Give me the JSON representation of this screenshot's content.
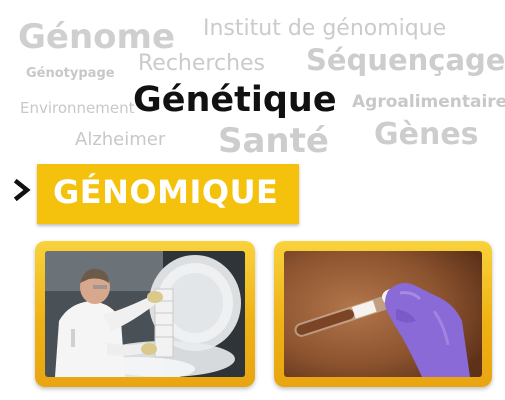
{
  "word_cloud": {
    "genome": "Génome",
    "institut": "Institut de génomique",
    "genotypage": "Génotypage",
    "recherches": "Recherches",
    "sequencage": "Séquençage",
    "environnement": "Environnement",
    "genetique": "Génétique",
    "agroalimentaire": "Agroalimentaire",
    "alzheimer": "Alzheimer",
    "sante": "Santé",
    "genes": "Gènes"
  },
  "banner": {
    "icon": "chevron-right-icon",
    "label": "GÉNOMIQUE"
  },
  "photos": [
    {
      "subject": "scientist in lab coat handling a freezer rack with vapor"
    },
    {
      "subject": "gloved hand holding a test tube"
    }
  ],
  "colors": {
    "accent": "#f4c20d",
    "word_cloud_gray": "#cfcfcf",
    "highlight_word": "#111111",
    "glove_purple": "#8a6ad6"
  }
}
